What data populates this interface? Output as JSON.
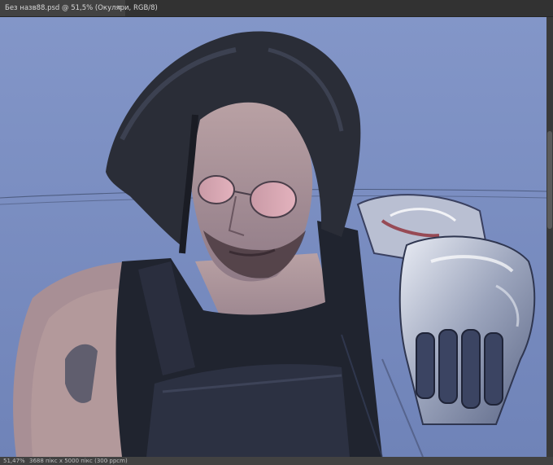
{
  "document_tab": {
    "title": "Без назв88.psd @ 51,5% (Окуляри, RGB/8)",
    "close_glyph": "×"
  },
  "canvas": {
    "background_color": "#7f92c4",
    "subject": "digital painting of a long-haired man with tinted round glasses, goatee, black tactical vest and chrome cybernetic arm"
  },
  "status_bar": {
    "zoom": "51,47%",
    "doc_info": "3688 пікс x 5000 пікс (300 ppcm)",
    "arrow": "›"
  },
  "colors": {
    "app_bg": "#535353",
    "tab_bar": "#323232",
    "active_tab": "#424242",
    "canvas_blue": "#7f92c4"
  }
}
